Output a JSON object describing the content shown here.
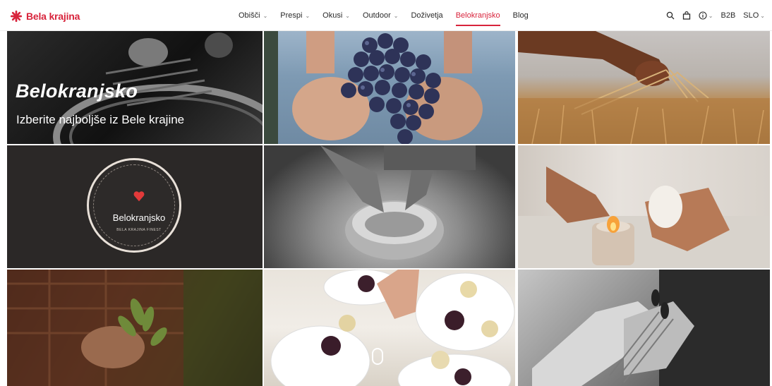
{
  "header": {
    "logo_text": "Bela krajina",
    "nav": [
      {
        "label": "Obišči",
        "has_dropdown": true
      },
      {
        "label": "Prespi",
        "has_dropdown": true
      },
      {
        "label": "Okusi",
        "has_dropdown": true
      },
      {
        "label": "Outdoor",
        "has_dropdown": true
      },
      {
        "label": "Doživetja",
        "has_dropdown": false
      },
      {
        "label": "Belokranjsko",
        "has_dropdown": false,
        "active": true
      },
      {
        "label": "Blog",
        "has_dropdown": false
      }
    ],
    "tools": {
      "search_icon": "search-icon",
      "cart_icon": "shopping-bag-icon",
      "info_icon": "info-icon",
      "b2b": "B2B",
      "language": "SLO"
    }
  },
  "hero": {
    "title": "Belokranjsko",
    "subtitle": "Izberite najboljše iz Bele krajine"
  },
  "badge": {
    "title": "Belokranjsko",
    "subtitle": "BELA KRAJINA FINEST"
  },
  "colors": {
    "brand": "#d8243c",
    "text": "#2a2a2a"
  }
}
